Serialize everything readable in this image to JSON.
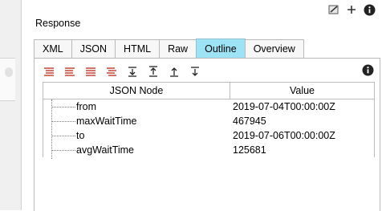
{
  "response": {
    "title": "Response"
  },
  "tabs": [
    {
      "label": "XML",
      "active": false
    },
    {
      "label": "JSON",
      "active": false
    },
    {
      "label": "HTML",
      "active": false
    },
    {
      "label": "Raw",
      "active": false
    },
    {
      "label": "Outline",
      "active": true
    },
    {
      "label": "Overview",
      "active": false
    }
  ],
  "toolbar_icons": [
    "expand-all-icon",
    "collapse-all-icon",
    "expand-level-icon",
    "collapse-level-icon",
    "move-down-icon",
    "move-up-icon",
    "move-top-icon",
    "move-bottom-icon"
  ],
  "grid": {
    "headers": {
      "node": "JSON Node",
      "value": "Value"
    },
    "rows": [
      {
        "node": "from",
        "value": "2019-07-04T00:00:00Z"
      },
      {
        "node": "maxWaitTime",
        "value": "467945"
      },
      {
        "node": "to",
        "value": "2019-07-06T00:00:00Z"
      },
      {
        "node": "avgWaitTime",
        "value": "125681"
      }
    ]
  },
  "colors": {
    "active_tab": "#9ee3f5",
    "icon_red": "#c0392b"
  }
}
